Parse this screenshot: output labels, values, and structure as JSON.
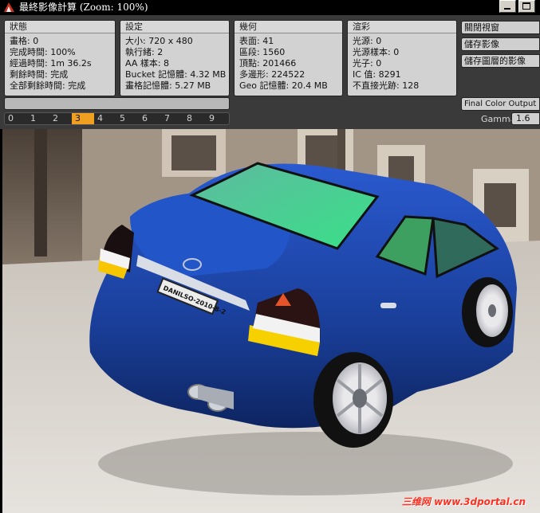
{
  "window": {
    "title": "最終影像計算 (Zoom: 100%)"
  },
  "status": {
    "header": "狀態",
    "rows": [
      "畫格: 0",
      "完成時間: 100%",
      "經過時間: 1m 36.2s",
      "剩餘時間: 完成",
      "全部剩餘時間: 完成"
    ]
  },
  "settings": {
    "header": "設定",
    "rows": [
      "大小: 720 x 480",
      "執行緒: 2",
      "AA 樣本: 8",
      "Bucket 記憶體: 4.32 MB",
      "畫格記憶體: 5.27 MB"
    ]
  },
  "geometry": {
    "header": "幾何",
    "rows": [
      "表面: 41",
      "區段: 1560",
      "頂點: 201466",
      "多邊形: 224522",
      "Geo 記憶體: 20.4 MB"
    ]
  },
  "rendering": {
    "header": "渲彩",
    "rows": [
      "光源: 0",
      "光源樣本: 0",
      "光子: 0",
      "IC 值: 8291",
      "不直接光跡: 128"
    ]
  },
  "buttons": {
    "close_view": "關閉視窗",
    "save_image": "儲存影像",
    "save_layers": "儲存圖層的影像",
    "final_output": "Final Color Output"
  },
  "gamma": {
    "label": "Gamma",
    "value": "1.6"
  },
  "progress": {
    "fraction": 1.0
  },
  "layer_tabs": {
    "labels": [
      "0",
      "1",
      "2",
      "3",
      "4",
      "5",
      "6",
      "7",
      "8",
      "9"
    ],
    "active_index": 3
  },
  "render": {
    "plate_text": "DANILSO-2010-8-2",
    "watermark": "三维网 www.3dportal.cn",
    "car_color": "#1a44a0",
    "accent": "#f0a020"
  }
}
